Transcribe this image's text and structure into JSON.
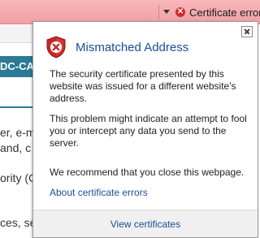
{
  "address_bar": {
    "security_status": "Certificate error",
    "status_icon": "cert-error-icon",
    "status_color": "#d22a2a",
    "background": "#f4a9ad"
  },
  "background_page": {
    "tab_fragment": "DC-CA",
    "text_fragments": [
      "er, e-m",
      "and, c",
      "ority (C",
      "ces, se"
    ],
    "accent": "#2c7a95"
  },
  "popup": {
    "title": "Mismatched Address",
    "title_color": "#1a4d9c",
    "icon": "shield-error-icon",
    "paragraphs": [
      "The security certificate presented by this website was issued for a different website's address.",
      "This problem might indicate an attempt to fool you or intercept any data you send to the server.",
      "We recommend that you close this webpage."
    ],
    "link_label": "About certificate errors",
    "footer_button": "View certificates",
    "close_icon": "close-icon"
  }
}
